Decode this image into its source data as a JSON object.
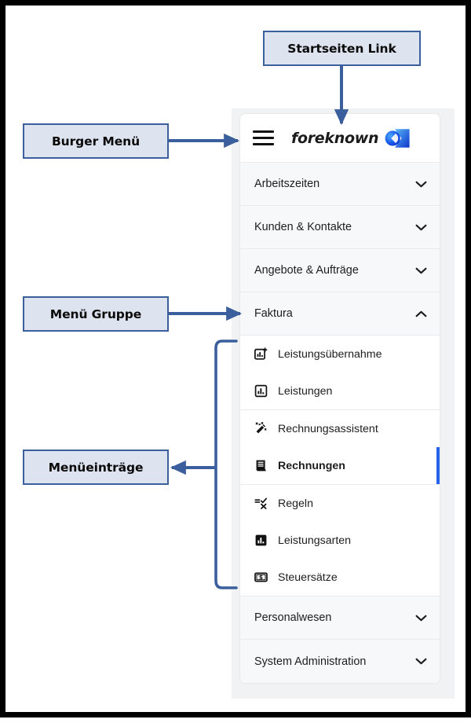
{
  "annotations": {
    "startseiten_link": "Startseiten Link",
    "burger_menu": "Burger Menü",
    "menu_gruppe": "Menü Gruppe",
    "menueintraege": "Menüeinträge"
  },
  "app": {
    "brand_name": "foreknown",
    "brand_logo_icon": "foreknown-logo-icon",
    "burger_icon": "hamburger-menu-icon",
    "accent_color": "#2563eb",
    "callout_fill": "#dde3ef",
    "callout_border": "#3a5f9c",
    "menu": {
      "groups": [
        {
          "label": "Arbeitszeiten",
          "state": "collapsed",
          "chevron": "chevron-down-icon"
        },
        {
          "label": "Kunden & Kontakte",
          "state": "collapsed",
          "chevron": "chevron-down-icon"
        },
        {
          "label": "Angebote & Aufträge",
          "state": "collapsed",
          "chevron": "chevron-down-icon"
        },
        {
          "label": "Faktura",
          "state": "expanded",
          "chevron": "chevron-up-icon"
        },
        {
          "label": "Personalwesen",
          "state": "collapsed",
          "chevron": "chevron-down-icon"
        },
        {
          "label": "System Administration",
          "state": "collapsed",
          "chevron": "chevron-down-icon"
        }
      ],
      "faktura_items": [
        {
          "label": "Leistungsübernahme",
          "icon": "chart-add-icon",
          "active": false
        },
        {
          "label": "Leistungen",
          "icon": "chart-box-icon",
          "active": false
        },
        {
          "label": "Rechnungsassistent",
          "icon": "magic-wand-icon",
          "active": false
        },
        {
          "label": "Rechnungen",
          "icon": "receipt-icon",
          "active": true
        },
        {
          "label": "Regeln",
          "icon": "rules-check-x-icon",
          "active": false
        },
        {
          "label": "Leistungsarten",
          "icon": "chart-filled-icon",
          "active": false
        },
        {
          "label": "Steuersätze",
          "icon": "money-tax-icon",
          "active": false
        }
      ]
    }
  }
}
